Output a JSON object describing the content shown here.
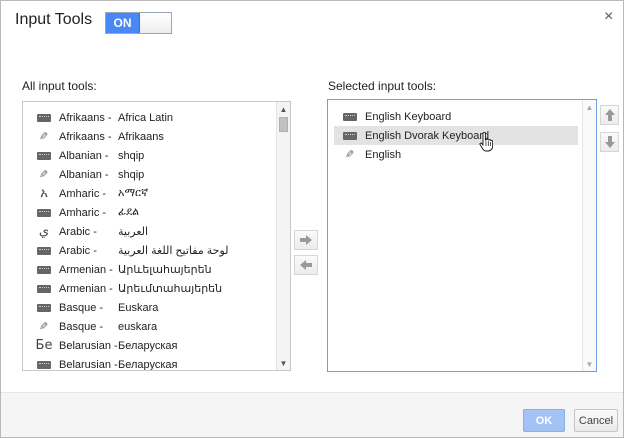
{
  "dialog": {
    "title": "Input Tools",
    "toggle_label": "ON",
    "close_glyph": "×"
  },
  "all_tools": {
    "label": "All input tools:",
    "items": [
      {
        "icon": "keyboard-icon",
        "name": "Afrikaans -",
        "native": "Africa Latin"
      },
      {
        "icon": "pencil-icon",
        "name": "Afrikaans -",
        "native": "Afrikaans"
      },
      {
        "icon": "keyboard-icon",
        "name": "Albanian -",
        "native": "shqip"
      },
      {
        "icon": "pencil-icon",
        "name": "Albanian -",
        "native": "shqip"
      },
      {
        "icon": "character-icon",
        "glyph": "አ",
        "name": "Amharic -",
        "native": "አማርኛ"
      },
      {
        "icon": "keyboard-icon",
        "name": "Amharic -",
        "native": "ፊደል"
      },
      {
        "icon": "character-icon",
        "glyph": "ي",
        "name": "Arabic -",
        "native": "العربية"
      },
      {
        "icon": "keyboard-icon",
        "name": "Arabic -",
        "native": "لوحة مفاتيح اللغة العربية"
      },
      {
        "icon": "keyboard-icon",
        "name": "Armenian -",
        "native": "Արևելահայերեն"
      },
      {
        "icon": "keyboard-icon",
        "name": "Armenian -",
        "native": "Արեւմտահայերեն"
      },
      {
        "icon": "keyboard-icon",
        "name": "Basque -",
        "native": "Euskara"
      },
      {
        "icon": "pencil-icon",
        "name": "Basque -",
        "native": "euskara"
      },
      {
        "icon": "character-icon",
        "glyph": "Бе",
        "name": "Belarusian -",
        "native": "Беларуская"
      },
      {
        "icon": "keyboard-icon",
        "name": "Belarusian -",
        "native": "Беларуская"
      }
    ]
  },
  "selected_tools": {
    "label": "Selected input tools:",
    "items": [
      {
        "icon": "keyboard-icon",
        "name": "English Keyboard",
        "highlighted": false
      },
      {
        "icon": "keyboard-icon",
        "name": "English Dvorak Keyboard",
        "highlighted": true
      },
      {
        "icon": "pencil-icon",
        "name": "English",
        "highlighted": false
      }
    ]
  },
  "footer": {
    "ok_label": "OK",
    "cancel_label": "Cancel"
  },
  "colors": {
    "toggle_on": "#4787f6",
    "ok_button": "#a4c2f4",
    "selected_border": "#6d9fe0",
    "highlight_row": "#e3e3e3"
  }
}
